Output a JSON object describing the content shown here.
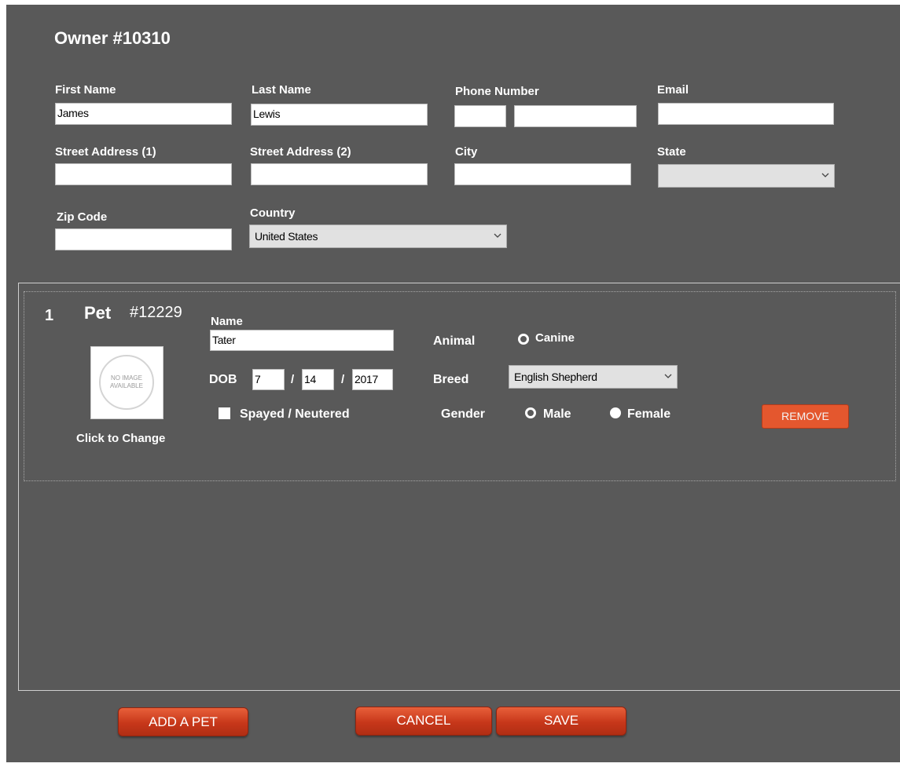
{
  "owner": {
    "title": "Owner",
    "number": "#10310",
    "labels": {
      "first_name": "First Name",
      "last_name": "Last Name",
      "phone": "Phone Number",
      "email": "Email",
      "street1": "Street Address (1)",
      "street2": "Street Address (2)",
      "city": "City",
      "state": "State",
      "zip": "Zip Code",
      "country": "Country"
    },
    "values": {
      "first_name": "James",
      "last_name": "Lewis",
      "phone_area": "",
      "phone_number": "",
      "email": "",
      "street1": "",
      "street2": "",
      "city": "",
      "state": "",
      "zip": "",
      "country": "United States"
    }
  },
  "pet": {
    "index": "1",
    "title": "Pet",
    "number": "#12229",
    "image_text": "NO IMAGE AVAILABLE",
    "image_caption": "Click to Change",
    "labels": {
      "name": "Name",
      "dob": "DOB",
      "slash": "/",
      "spayed": "Spayed / Neutered",
      "animal": "Animal",
      "breed": "Breed",
      "gender": "Gender",
      "canine": "Canine",
      "male": "Male",
      "female": "Female"
    },
    "values": {
      "name": "Tater",
      "dob_month": "7",
      "dob_day": "14",
      "dob_year": "2017",
      "breed": "English Shepherd",
      "spayed_checked": false,
      "animal_selected": false,
      "gender_selected": "Female"
    },
    "remove_label": "REMOVE"
  },
  "actions": {
    "add_pet": "ADD A PET",
    "cancel": "CANCEL",
    "save": "SAVE"
  },
  "colors": {
    "background": "#595959",
    "button_red": "#c7371a",
    "remove_orange": "#e4572e"
  }
}
